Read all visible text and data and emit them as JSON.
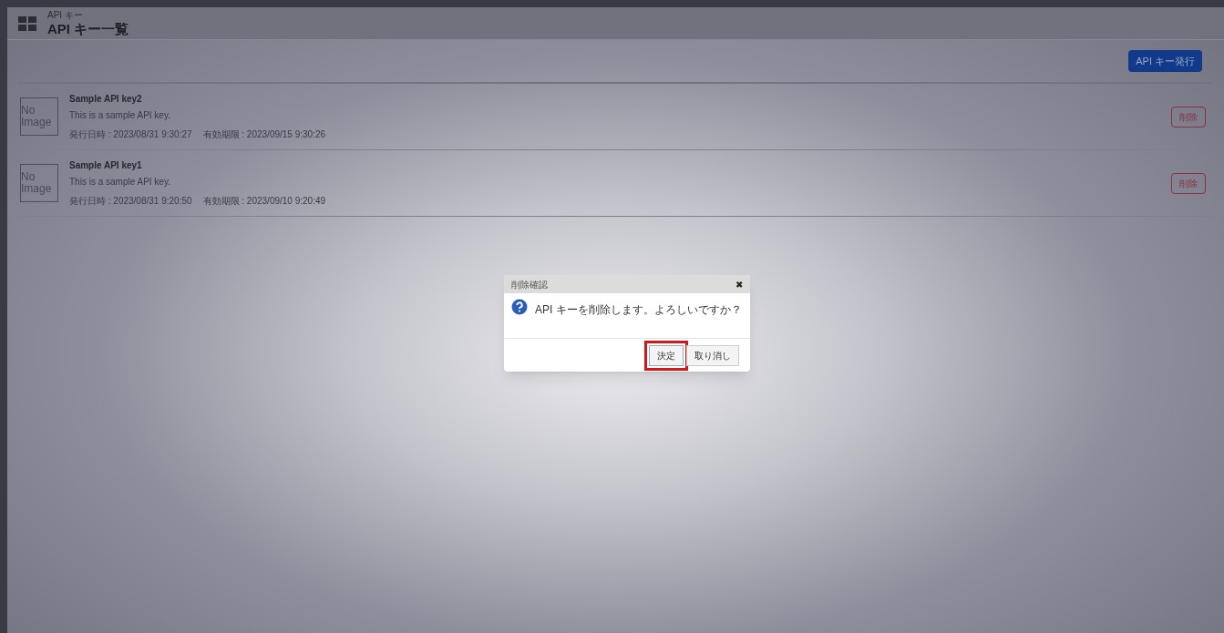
{
  "header": {
    "breadcrumb": "API キー",
    "title": "API キー一覧"
  },
  "toolbar": {
    "issue_button": "API キー発行"
  },
  "keys": [
    {
      "thumbnail": "No Image",
      "name": "Sample API key2",
      "description": "This is a sample API key.",
      "issued": "発行日時 : 2023/08/31 9:30:27",
      "expires": "有効期限 : 2023/09/15 9:30:26",
      "delete_button": "削除"
    },
    {
      "thumbnail": "No Image",
      "name": "Sample API key1",
      "description": "This is a sample API key.",
      "issued": "発行日時 : 2023/08/31 9:20:50",
      "expires": "有効期限 : 2023/09/10 9:20:49",
      "delete_button": "削除"
    }
  ],
  "dialog": {
    "title": "削除確認",
    "close": "✖",
    "message": "API キーを削除します。よろしいですか？",
    "buttons": [
      {
        "label": "決定",
        "highlighted": true
      },
      {
        "label": "取り消し",
        "highlighted": false
      }
    ]
  }
}
